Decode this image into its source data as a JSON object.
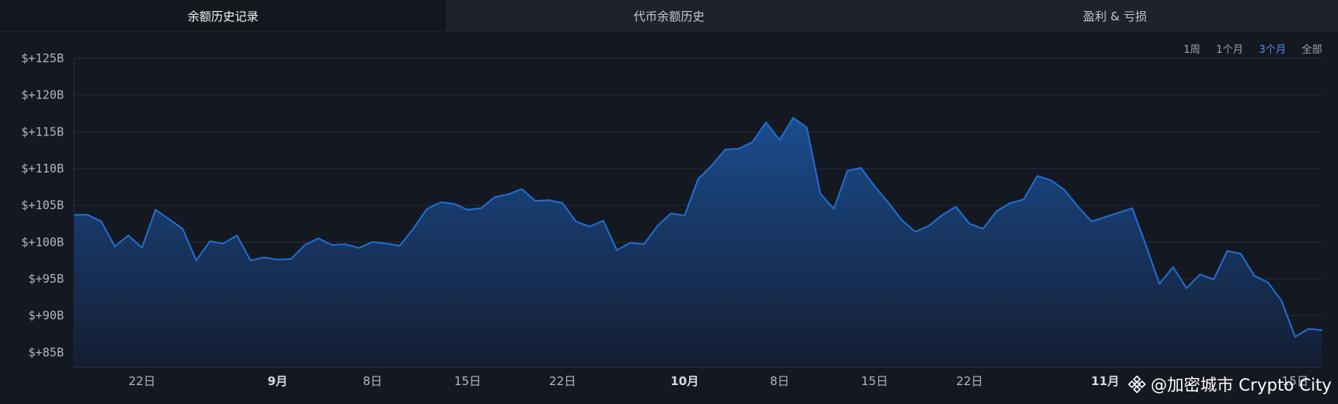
{
  "tabs": [
    {
      "label": "余额历史记录",
      "active": true
    },
    {
      "label": "代币余额历史",
      "active": false
    },
    {
      "label": "盈利 & 亏损",
      "active": false
    }
  ],
  "ranges": [
    {
      "label": "1周",
      "active": false
    },
    {
      "label": "1个月",
      "active": false
    },
    {
      "label": "3个月",
      "active": true
    },
    {
      "label": "全部",
      "active": false
    }
  ],
  "watermark": {
    "text": "@加密城市 Crypto City",
    "icon": "binance-logo-icon"
  },
  "colors": {
    "background": "#141821",
    "line": "#1f6fd1",
    "fill_top": "#1b4f93",
    "fill_bottom": "#141d33",
    "grid": "#262b36"
  },
  "chart_data": {
    "type": "area",
    "title": "",
    "xlabel": "",
    "ylabel": "",
    "ylim": [
      83,
      125
    ],
    "yticks": [
      {
        "value": 125,
        "label": "$+125B"
      },
      {
        "value": 120,
        "label": "$+120B"
      },
      {
        "value": 115,
        "label": "$+115B"
      },
      {
        "value": 110,
        "label": "$+110B"
      },
      {
        "value": 105,
        "label": "$+105B"
      },
      {
        "value": 100,
        "label": "$+100B"
      },
      {
        "value": 95,
        "label": "$+95B"
      },
      {
        "value": 90,
        "label": "$+90B"
      },
      {
        "value": 85,
        "label": "$+85B"
      }
    ],
    "xticks": [
      {
        "index": 5,
        "label": "22日",
        "bold": false
      },
      {
        "index": 15,
        "label": "9月",
        "bold": true
      },
      {
        "index": 22,
        "label": "8日",
        "bold": false
      },
      {
        "index": 29,
        "label": "15日",
        "bold": false
      },
      {
        "index": 36,
        "label": "22日",
        "bold": false
      },
      {
        "index": 45,
        "label": "10月",
        "bold": true
      },
      {
        "index": 52,
        "label": "8日",
        "bold": false
      },
      {
        "index": 59,
        "label": "15日",
        "bold": false
      },
      {
        "index": 66,
        "label": "22日",
        "bold": false
      },
      {
        "index": 76,
        "label": "11月",
        "bold": true
      },
      {
        "index": 90,
        "label": "15日",
        "bold": false
      }
    ],
    "series": [
      {
        "values": [
          103.7,
          103.7,
          102.8,
          99.4,
          100.9,
          99.2,
          104.4,
          103.1,
          101.8,
          97.5,
          100.1,
          99.8,
          100.9,
          97.5,
          97.9,
          97.6,
          97.7,
          99.6,
          100.5,
          99.6,
          99.7,
          99.2,
          100.0,
          99.8,
          99.5,
          101.8,
          104.5,
          105.4,
          105.2,
          104.4,
          104.6,
          106.1,
          106.5,
          107.2,
          105.6,
          105.7,
          105.3,
          102.8,
          102.1,
          102.9,
          98.9,
          99.9,
          99.7,
          102.2,
          103.9,
          103.6,
          108.6,
          110.4,
          112.6,
          112.7,
          113.6,
          116.3,
          113.9,
          116.9,
          115.6,
          106.6,
          104.5,
          109.7,
          110.1,
          107.6,
          105.4,
          103.0,
          101.4,
          102.2,
          103.7,
          104.8,
          102.5,
          101.8,
          104.2,
          105.3,
          105.8,
          109.0,
          108.4,
          107.1,
          104.8,
          102.8,
          103.4,
          104.0,
          104.6,
          99.6,
          94.3,
          96.6,
          93.7,
          95.6,
          94.9,
          98.8,
          98.4,
          95.4,
          94.5,
          92.0,
          87.1,
          88.2,
          88.0
        ]
      }
    ]
  }
}
